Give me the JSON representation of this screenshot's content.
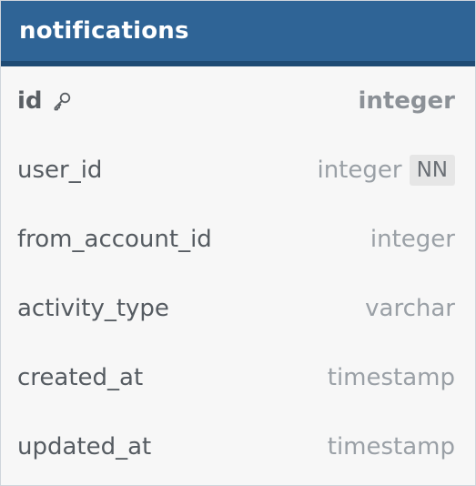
{
  "table": {
    "title": "notifications",
    "fields": [
      {
        "name": "id",
        "type": "integer",
        "primary_key": true,
        "not_null": false,
        "icon": "key-icon"
      },
      {
        "name": "user_id",
        "type": "integer",
        "primary_key": false,
        "not_null": true,
        "badge": "NN"
      },
      {
        "name": "from_account_id",
        "type": "integer",
        "primary_key": false,
        "not_null": false
      },
      {
        "name": "activity_type",
        "type": "varchar",
        "primary_key": false,
        "not_null": false
      },
      {
        "name": "created_at",
        "type": "timestamp",
        "primary_key": false,
        "not_null": false
      },
      {
        "name": "updated_at",
        "type": "timestamp",
        "primary_key": false,
        "not_null": false
      }
    ]
  },
  "colors": {
    "header_bg": "#2f6496",
    "header_border": "#1f4b74",
    "body_bg": "#f7f7f7",
    "field_name": "#555b61",
    "field_type": "#9aa0a6",
    "badge_bg": "#e6e6e6"
  }
}
